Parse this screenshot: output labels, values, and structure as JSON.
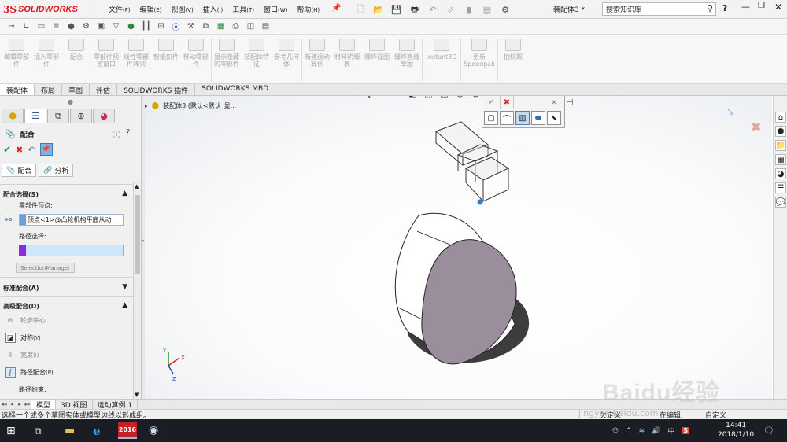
{
  "app": {
    "brand_ds": "3S",
    "brand_name": "SOLIDWORKS",
    "document_title": "装配体3 *"
  },
  "menu": [
    {
      "label": "文件",
      "key": "(F)"
    },
    {
      "label": "编辑",
      "key": "(E)"
    },
    {
      "label": "视图",
      "key": "(V)"
    },
    {
      "label": "插入",
      "key": "(I)"
    },
    {
      "label": "工具",
      "key": "(T)"
    },
    {
      "label": "窗口",
      "key": "(W)"
    },
    {
      "label": "帮助",
      "key": "(H)"
    }
  ],
  "search": {
    "placeholder": "搜索知识库"
  },
  "command_manager": [
    {
      "label": "编辑零部件",
      "icon": "edit-component-icon"
    },
    {
      "label": "插入零部件",
      "icon": "insert-component-icon"
    },
    {
      "label": "配合",
      "icon": "mate-icon"
    },
    {
      "label": "零部件预览窗口",
      "icon": "preview-window-icon"
    },
    {
      "label": "线性零部件阵列",
      "icon": "linear-pattern-icon"
    },
    {
      "label": "智能扣件",
      "icon": "smart-fastener-icon"
    },
    {
      "label": "移动零部件",
      "icon": "move-component-icon"
    },
    {
      "label": "显示隐藏的零部件",
      "icon": "show-hidden-icon"
    },
    {
      "label": "装配体特征",
      "icon": "assembly-feature-icon"
    },
    {
      "label": "参考几何体",
      "icon": "reference-geometry-icon"
    },
    {
      "label": "新建运动算例",
      "icon": "motion-study-icon"
    },
    {
      "label": "材料明细表",
      "icon": "bom-icon"
    },
    {
      "label": "爆炸视图",
      "icon": "exploded-view-icon"
    },
    {
      "label": "爆炸直线草图",
      "icon": "explode-line-icon"
    },
    {
      "label": "Instant3D",
      "icon": "instant3d-icon"
    },
    {
      "label": "更新Speedpak",
      "icon": "speedpak-icon"
    },
    {
      "label": "拍快照",
      "icon": "snapshot-icon"
    }
  ],
  "cm_tabs": [
    "装配体",
    "布局",
    "草图",
    "评估",
    "SOLIDWORKS 插件",
    "SOLIDWORKS MBD"
  ],
  "property_manager": {
    "title": "配合",
    "subtabs": [
      "配合",
      "分析"
    ],
    "mate_selections": {
      "header": "配合选择(S)",
      "vertex_label": "零部件顶点:",
      "vertex_value": "顶点<1>@凸轮机构平底从动",
      "path_label": "路径选择:",
      "selmgr_button": "SelectionManager"
    },
    "standard": {
      "header": "标准配合(A)"
    },
    "advanced": {
      "header": "高级配合(D)",
      "options": [
        {
          "label": "轮廓中心",
          "enabled": false,
          "icon": "profile-center-icon"
        },
        {
          "label": "对称",
          "key": "(Y)",
          "enabled": true,
          "icon": "symmetric-icon"
        },
        {
          "label": "宽度",
          "key": "(I)",
          "enabled": false,
          "icon": "width-icon"
        },
        {
          "label": "路径配合",
          "key": "(P)",
          "enabled": true,
          "selected": true,
          "icon": "path-mate-icon"
        },
        {
          "label": "路径约束:",
          "enabled": true,
          "icon": ""
        }
      ]
    }
  },
  "tree": {
    "root": "装配体3 (默认<默认_显..."
  },
  "model_tabs": [
    "模型",
    "3D 视图",
    "运动算例 1"
  ],
  "status": {
    "text": "选择一个或多个草图实体或模型边线以形成组。",
    "right1": "欠定义",
    "right2": "在编辑",
    "right3": "自定义"
  },
  "taskbar": {
    "clock_time": "14:41",
    "clock_date": "2018/1/10",
    "ime": "中",
    "sw_label": "2016"
  },
  "watermark": {
    "main": "Baidu经验",
    "sub": "jingyan.baidu.com"
  },
  "colors": {
    "brand_red": "#d71920",
    "face_fill": "#9b8e9c",
    "selection_blue": "#3e78c9",
    "path_color": "#8a2be2"
  }
}
